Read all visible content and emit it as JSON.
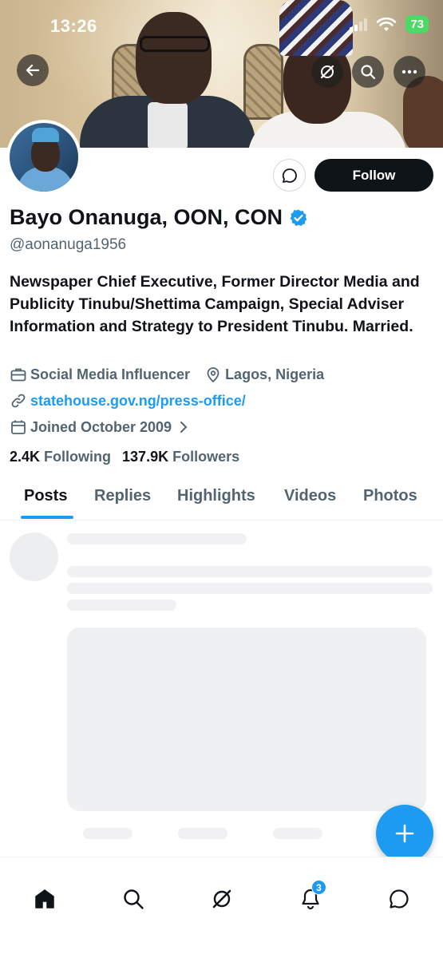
{
  "status_bar": {
    "time": "13:26",
    "battery": "73"
  },
  "profile": {
    "name": "Bayo Onanuga, OON, CON",
    "handle": "@aonanuga1956",
    "bio": "Newspaper Chief Executive, Former Director Media and Publicity Tinubu/Shettima Campaign, Special Adviser Information and Strategy to President Tinubu. Married.",
    "category": "Social Media Influencer",
    "location": "Lagos, Nigeria",
    "website": "statehouse.gov.ng/press-office/",
    "joined": "Joined October 2009",
    "following_count": "2.4K",
    "following_label": "Following",
    "followers_count": "137.9K",
    "followers_label": "Followers"
  },
  "actions": {
    "follow_label": "Follow"
  },
  "tabs": [
    {
      "label": "Posts",
      "active": true
    },
    {
      "label": "Replies"
    },
    {
      "label": "Highlights"
    },
    {
      "label": "Videos"
    },
    {
      "label": "Photos"
    }
  ],
  "bottom_nav": {
    "items": [
      "home-icon",
      "search-icon",
      "grok-icon",
      "notifications-icon",
      "messages-icon"
    ],
    "notification_badge": "3"
  },
  "colors": {
    "accent": "#1d9bf0",
    "text": "#0f1419",
    "secondary": "#536471"
  }
}
